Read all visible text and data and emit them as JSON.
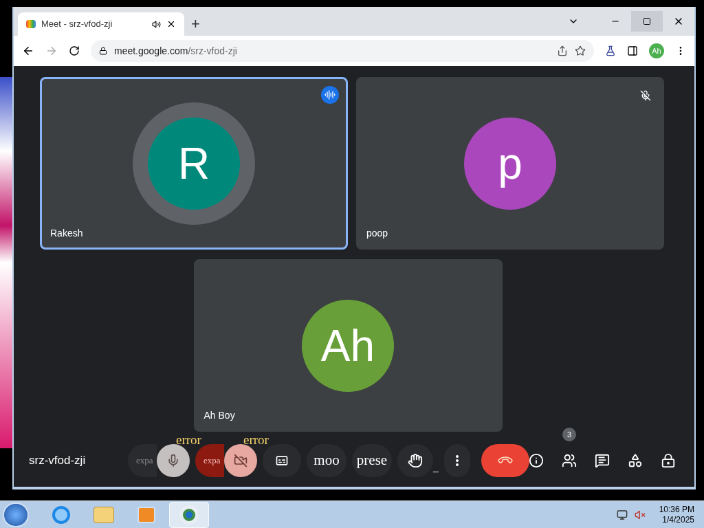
{
  "browser": {
    "tab": {
      "title": "Meet - srz-vfod-zji",
      "audio": true
    },
    "new_tab": "+",
    "url_host": "meet.google.com",
    "url_path": "/srz-vfod-zji",
    "profile": "Ah"
  },
  "meet": {
    "tiles": [
      {
        "name": "Rakesh",
        "initial": "R",
        "color": "#00897b",
        "speaking": true,
        "muted": false
      },
      {
        "name": "poop",
        "initial": "p",
        "color": "#ab47bc",
        "speaking": false,
        "muted": true
      },
      {
        "name": "Ah Boy",
        "initial": "Ah",
        "color": "#689f38",
        "speaking": false,
        "muted": false
      }
    ],
    "meeting_code": "srz-vfod-zji",
    "controls": [
      {
        "kind": "mic",
        "label": "expa",
        "overlay": "error"
      },
      {
        "kind": "camera",
        "label": "expa",
        "overlay": "error"
      },
      {
        "kind": "captions"
      },
      {
        "kind": "text",
        "label": "moo"
      },
      {
        "kind": "text",
        "label": "prese"
      },
      {
        "kind": "hand",
        "suffix": "_"
      },
      {
        "kind": "more"
      },
      {
        "kind": "end"
      }
    ],
    "side_controls": [
      {
        "kind": "info"
      },
      {
        "kind": "people",
        "badge": "3"
      },
      {
        "kind": "chat"
      },
      {
        "kind": "activities"
      },
      {
        "kind": "host"
      }
    ]
  },
  "taskbar": {
    "items": [
      {
        "kind": "ie",
        "selected": false
      },
      {
        "kind": "folder",
        "selected": false
      },
      {
        "kind": "media",
        "selected": false
      },
      {
        "kind": "chrome",
        "selected": true
      }
    ],
    "time": "10:36 PM",
    "date": "1/4/2025"
  }
}
